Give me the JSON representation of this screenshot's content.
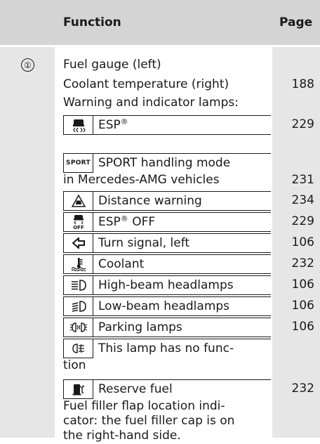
{
  "header": {
    "function_label": "Function",
    "page_label": "Page"
  },
  "section": {
    "marker": "①"
  },
  "intro": [
    {
      "text": "Fuel gauge (left)",
      "page": ""
    },
    {
      "text": "Coolant temperature (right)",
      "page": "188"
    },
    {
      "text": "Warning and indicator lamps:",
      "page": ""
    }
  ],
  "lamps": [
    {
      "icon": "esp-icon",
      "label": "ESP",
      "sup": "®",
      "label_after": "",
      "page": "229"
    },
    {
      "icon": "sport-icon",
      "icon_text": "SPORT",
      "label": "SPORT handling mode",
      "page": ""
    },
    {
      "icon": "distance-warning-icon",
      "label": "Distance warning",
      "page": "234"
    },
    {
      "icon": "esp-off-icon",
      "label": "ESP",
      "sup": "®",
      "label_after": " OFF",
      "page": "229"
    },
    {
      "icon": "turn-signal-left-icon",
      "label": "Turn signal, left",
      "page": "106"
    },
    {
      "icon": "coolant-icon",
      "label": "Coolant",
      "page": "232"
    },
    {
      "icon": "high-beam-icon",
      "label": "High-beam headlamps",
      "page": "106"
    },
    {
      "icon": "low-beam-icon",
      "label": "Low-beam headlamps",
      "page": "106"
    },
    {
      "icon": "parking-lamps-icon",
      "label": "Parking lamps",
      "page": "106"
    },
    {
      "icon": "rear-fog-icon",
      "label": "This lamp has no func-",
      "page": ""
    },
    {
      "icon": "reserve-fuel-icon",
      "label": "Reserve fuel",
      "page": "232"
    }
  ],
  "continuations": {
    "sport": {
      "text": "in Mercedes-AMG vehicles",
      "page": "231"
    },
    "rear_fog": {
      "text": "tion"
    }
  },
  "footer_lines": [
    "Fuel filler flap location indi-",
    "cator: the fuel filler cap is on",
    "the right-hand side."
  ]
}
